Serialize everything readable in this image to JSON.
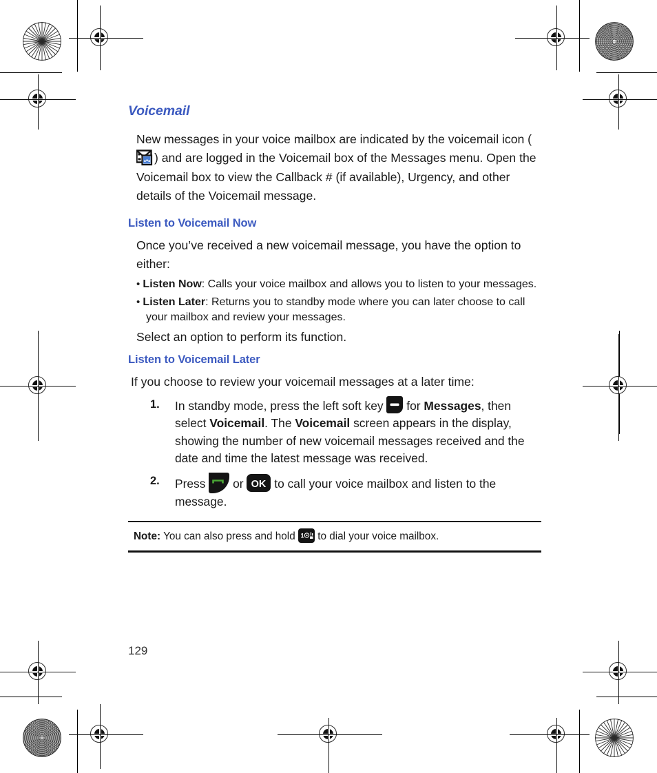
{
  "page": {
    "number": "129",
    "accent_color": "#3c5ac0",
    "text_color": "#1a1a1a"
  },
  "section": {
    "title": "Voicemail",
    "intro_part1": "New messages in your voice mailbox are indicated by the voicemail icon (",
    "intro_part2": ") and are logged in the Voicemail box of the Messages menu. Open the Voicemail box to view the Callback # (if available), Urgency, and other details of the Voicemail message."
  },
  "listen_now": {
    "heading": "Listen to Voicemail Now",
    "intro": "Once you’ve received a new voicemail message, you have the option to either:",
    "bullets": [
      {
        "term": "Listen Now",
        "rest": ": Calls your voice mailbox and allows you to listen to your messages."
      },
      {
        "term": "Listen Later",
        "rest": ": Returns you to standby mode where you can later choose to call your mailbox and review your messages."
      }
    ],
    "closing": "Select an option to perform its function."
  },
  "listen_later": {
    "heading": "Listen to Voicemail Later",
    "intro": "If you choose to review your voicemail messages at a later time:",
    "steps": [
      {
        "number": "1.",
        "p1": "In standby mode, press the left soft key ",
        "p2": " for ",
        "b1": "Messages",
        "p3": ", then select ",
        "b2": "Voicemail",
        "p4": ". The ",
        "b3": "Voicemail",
        "p5": " screen appears in the display, showing the number of new voicemail messages received and the date and time the latest message was received."
      },
      {
        "number": "2.",
        "p1": "Press ",
        "p2": " or ",
        "p3": " to call your voice mailbox and listen to the message."
      }
    ]
  },
  "note": {
    "label": "Note:",
    "part1": " You can also press and hold ",
    "part2": " to dial your voice mailbox."
  },
  "icons": {
    "voicemail_icon": "voicemail-envelope-icon",
    "left_soft_key": "left-soft-key-icon",
    "send_key": "send-call-key-icon",
    "ok_key": "ok-key-icon",
    "one_key": "one-voicemail-key-icon",
    "ok_key_label": "OK",
    "one_key_label": "1"
  }
}
